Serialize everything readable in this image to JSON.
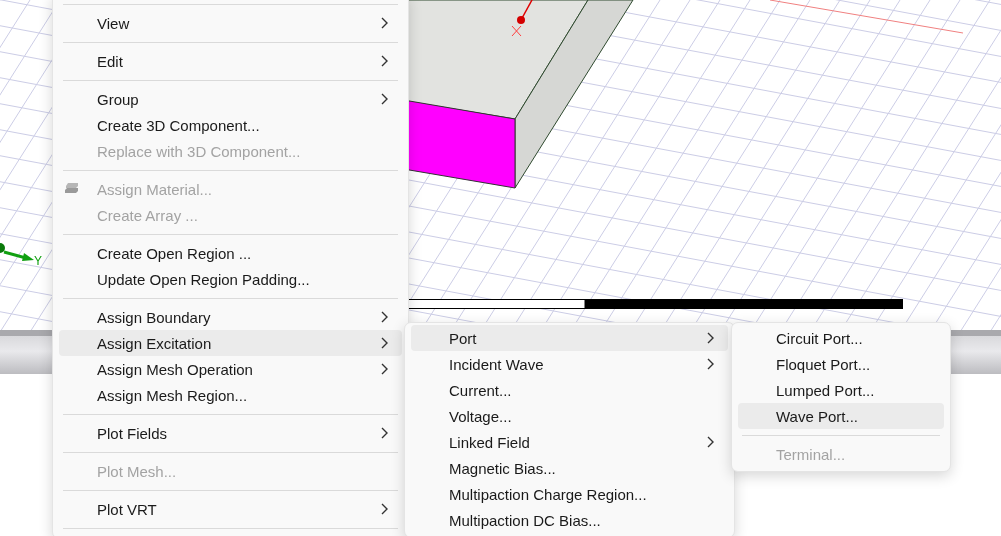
{
  "viewport": {
    "axis_label": "Y"
  },
  "menus": [
    {
      "items": [
        {
          "kind": "separator"
        },
        {
          "kind": "item",
          "label": "View",
          "selected": false,
          "disabled": false,
          "submenu": true
        },
        {
          "kind": "separator"
        },
        {
          "kind": "item",
          "label": "Edit",
          "selected": false,
          "disabled": false,
          "submenu": true
        },
        {
          "kind": "separator"
        },
        {
          "kind": "item",
          "label": "Group",
          "selected": false,
          "disabled": false,
          "submenu": true
        },
        {
          "kind": "item",
          "label": "Create 3D Component...",
          "selected": false,
          "disabled": false,
          "submenu": false
        },
        {
          "kind": "item",
          "label": "Replace with 3D Component...",
          "selected": false,
          "disabled": true,
          "submenu": false
        },
        {
          "kind": "separator"
        },
        {
          "kind": "item",
          "label": "Assign Material...",
          "selected": false,
          "disabled": true,
          "submenu": false,
          "has_icon": true
        },
        {
          "kind": "item",
          "label": "Create Array ...",
          "selected": false,
          "disabled": true,
          "submenu": false
        },
        {
          "kind": "separator"
        },
        {
          "kind": "item",
          "label": "Create Open Region ...",
          "selected": false,
          "disabled": false,
          "submenu": false
        },
        {
          "kind": "item",
          "label": "Update Open Region Padding...",
          "selected": false,
          "disabled": false,
          "submenu": false
        },
        {
          "kind": "separator"
        },
        {
          "kind": "item",
          "label": "Assign Boundary",
          "selected": false,
          "disabled": false,
          "submenu": true
        },
        {
          "kind": "item",
          "label": "Assign Excitation",
          "selected": true,
          "disabled": false,
          "submenu": true
        },
        {
          "kind": "item",
          "label": "Assign Mesh Operation",
          "selected": false,
          "disabled": false,
          "submenu": true
        },
        {
          "kind": "item",
          "label": "Assign Mesh Region...",
          "selected": false,
          "disabled": false,
          "submenu": false
        },
        {
          "kind": "separator"
        },
        {
          "kind": "item",
          "label": "Plot Fields",
          "selected": false,
          "disabled": false,
          "submenu": true
        },
        {
          "kind": "separator"
        },
        {
          "kind": "item",
          "label": "Plot Mesh...",
          "selected": false,
          "disabled": true,
          "submenu": false
        },
        {
          "kind": "separator"
        },
        {
          "kind": "item",
          "label": "Plot VRT",
          "selected": false,
          "disabled": false,
          "submenu": true
        },
        {
          "kind": "separator"
        }
      ]
    },
    {
      "items": [
        {
          "kind": "item",
          "label": "Port",
          "selected": true,
          "disabled": false,
          "submenu": true
        },
        {
          "kind": "item",
          "label": "Incident Wave",
          "selected": false,
          "disabled": false,
          "submenu": true
        },
        {
          "kind": "item",
          "label": "Current...",
          "selected": false,
          "disabled": false,
          "submenu": false
        },
        {
          "kind": "item",
          "label": "Voltage...",
          "selected": false,
          "disabled": false,
          "submenu": false
        },
        {
          "kind": "item",
          "label": "Linked Field",
          "selected": false,
          "disabled": false,
          "submenu": true
        },
        {
          "kind": "item",
          "label": "Magnetic Bias...",
          "selected": false,
          "disabled": false,
          "submenu": false
        },
        {
          "kind": "item",
          "label": "Multipaction Charge Region...",
          "selected": false,
          "disabled": false,
          "submenu": false
        },
        {
          "kind": "item",
          "label": "Multipaction DC Bias...",
          "selected": false,
          "disabled": false,
          "submenu": false
        }
      ]
    },
    {
      "items": [
        {
          "kind": "item",
          "label": "Circuit Port...",
          "selected": false,
          "disabled": false,
          "submenu": false
        },
        {
          "kind": "item",
          "label": "Floquet Port...",
          "selected": false,
          "disabled": false,
          "submenu": false
        },
        {
          "kind": "item",
          "label": "Lumped Port...",
          "selected": false,
          "disabled": false,
          "submenu": false
        },
        {
          "kind": "item",
          "label": "Wave Port...",
          "selected": true,
          "disabled": false,
          "submenu": false
        },
        {
          "kind": "separator"
        },
        {
          "kind": "item",
          "label": "Terminal...",
          "selected": false,
          "disabled": true,
          "submenu": false
        }
      ]
    }
  ]
}
